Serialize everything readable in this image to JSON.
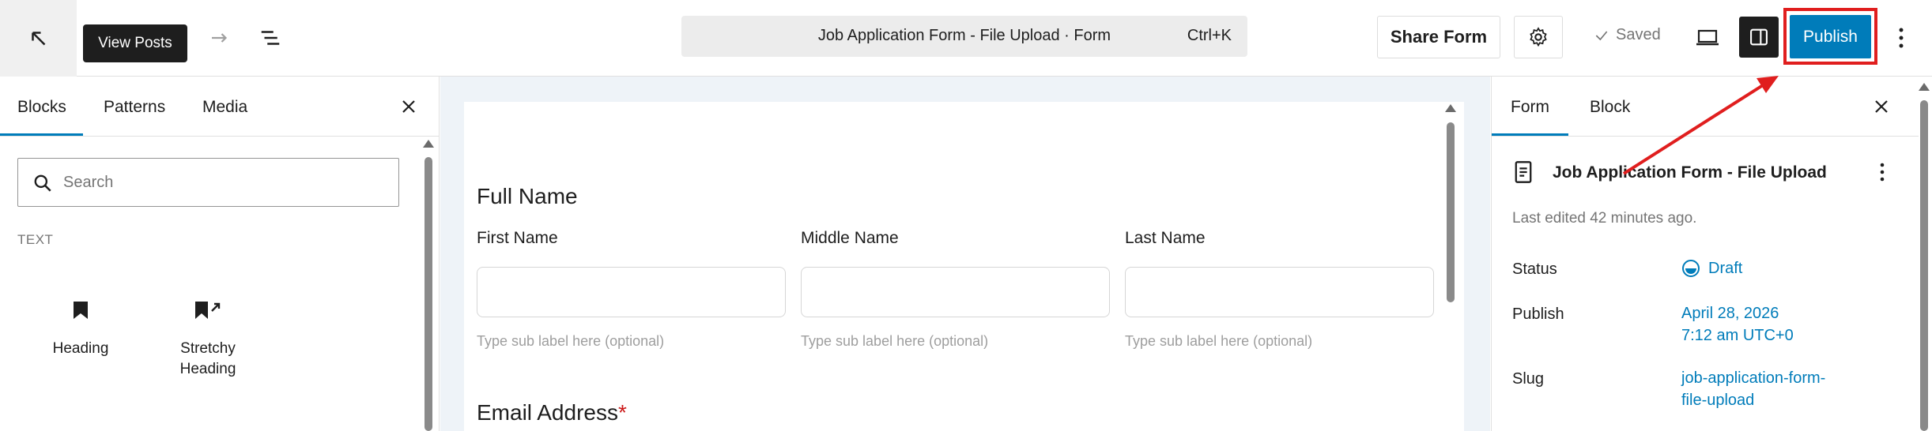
{
  "toolbar": {
    "tooltip": "View Posts",
    "command_title": "Job Application Form - File Upload · Form",
    "command_shortcut": "Ctrl+K",
    "share_label": "Share Form",
    "saved_label": "Saved",
    "publish_label": "Publish"
  },
  "inserter": {
    "tabs": [
      "Blocks",
      "Patterns",
      "Media"
    ],
    "search_placeholder": "Search",
    "section_label": "TEXT",
    "blocks": [
      {
        "label": "Heading",
        "icon": "bookmark-icon"
      },
      {
        "label": "Stretchy Heading",
        "icon": "bookmark-arrow-icon"
      }
    ]
  },
  "form": {
    "full_name_heading": "Full Name",
    "name_fields": [
      {
        "label": "First Name",
        "hint": "Type sub label here (optional)"
      },
      {
        "label": "Middle Name",
        "hint": "Type sub label here (optional)"
      },
      {
        "label": "Last Name",
        "hint": "Type sub label here (optional)"
      }
    ],
    "email_heading": "Email Address",
    "required_mark": "*"
  },
  "settings": {
    "tabs": [
      "Form",
      "Block"
    ],
    "document_title": "Job Application Form - File Upload",
    "last_edited": "Last edited 42 minutes ago.",
    "status_label": "Status",
    "status_value": "Draft",
    "publish_label": "Publish",
    "publish_date": "April 28, 2026",
    "publish_time": "7:12 am UTC+0",
    "slug_label": "Slug",
    "slug_line1": "job-application-form-",
    "slug_line2": "file-upload"
  },
  "colors": {
    "accent": "#007cba",
    "annotation": "#e01e1e",
    "dark": "#1e1e1e"
  }
}
